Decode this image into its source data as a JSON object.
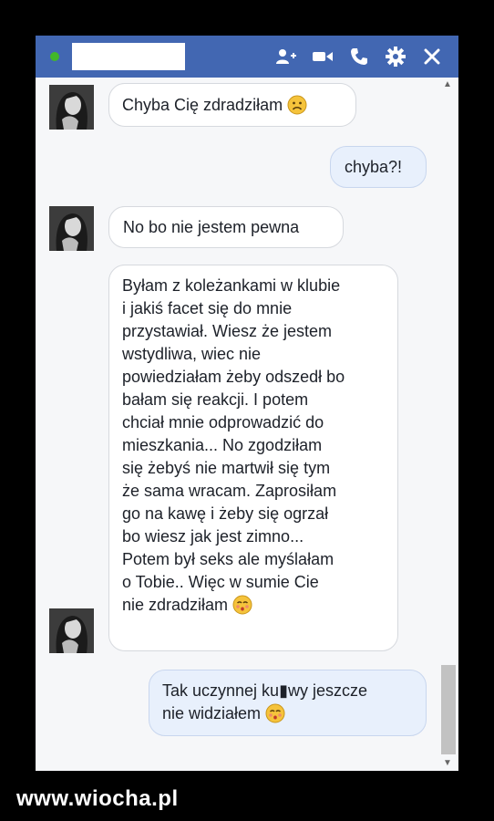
{
  "header": {
    "status_color": "#42b72a",
    "contact_name_redacted": "",
    "icons": [
      "add-person-icon",
      "video-camera-icon",
      "phone-icon",
      "gear-icon",
      "close-icon"
    ]
  },
  "messages": [
    {
      "direction": "in",
      "text": "Chyba Cię zdradziłam",
      "emoji": "sad-face"
    },
    {
      "direction": "out",
      "text": "chyba?!"
    },
    {
      "direction": "in",
      "text": "No bo nie jestem pewna"
    },
    {
      "direction": "in",
      "lines": [
        "Byłam z koleżankami w klubie",
        "i jakiś facet się do mnie",
        "przystawiał. Wiesz że jestem",
        "wstydliwa, wiec nie",
        "powiedziałam żeby odszedł bo",
        "bałam się reakcji. I potem",
        "chciał mnie odprowadzić do",
        "mieszkania... No zgodziłam",
        "się żebyś nie martwił się tym",
        "że sama wracam. Zaprosiłam",
        "go na kawę i żeby się ogrzał",
        "bo wiesz jak jest zimno...",
        "Potem był seks ale myślałam",
        "o Tobie.. Więc w sumie Cie",
        "nie zdradziłam"
      ],
      "emoji": "kiss-face"
    },
    {
      "direction": "out",
      "lines": [
        "Tak uczynnej ku▮wy jeszcze",
        "nie widziałem"
      ],
      "emoji": "kiss-face"
    }
  ],
  "watermark": "www.wiocha.pl"
}
